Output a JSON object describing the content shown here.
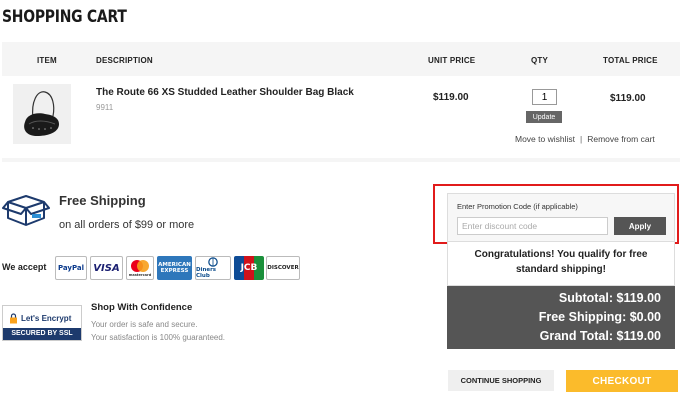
{
  "page": {
    "title": "SHOPPING CART"
  },
  "table": {
    "headers": {
      "item": "ITEM",
      "description": "DESCRIPTION",
      "unit_price": "UNIT PRICE",
      "qty": "QTY",
      "total_price": "TOTAL PRICE"
    }
  },
  "item": {
    "name": "The Route 66 XS Studded Leather Shoulder Bag Black",
    "sku": "9911",
    "unit_price": "$119.00",
    "qty": "1",
    "total_price": "$119.00",
    "update_label": "Update",
    "move_to_wishlist": "Move to wishlist",
    "separator": "|",
    "remove": "Remove from cart"
  },
  "shipping": {
    "title": "Free Shipping",
    "subtitle": "on all orders of $99 or more"
  },
  "payments": {
    "label": "We accept",
    "cards": [
      "PayPal",
      "VISA",
      "mastercard",
      "AMERICAN EXPRESS",
      "Diners Club",
      "JCB",
      "DISCOVER"
    ]
  },
  "security": {
    "badge_top": "Let's Encrypt",
    "badge_bottom": "SECURED BY SSL",
    "title": "Shop With Confidence",
    "line1": "Your order is safe and secure.",
    "line2": "Your satisfaction is 100% guaranteed."
  },
  "promo": {
    "label": "Enter Promotion Code (if applicable)",
    "placeholder": "Enter discount code",
    "value": "",
    "apply_label": "Apply"
  },
  "congrats": {
    "line1": "Congratulations! You qualify for free",
    "line2": "standard shipping!"
  },
  "totals": {
    "subtotal": "Subtotal: $119.00",
    "shipping": "Free Shipping: $0.00",
    "grand_total": "Grand Total: $119.00"
  },
  "actions": {
    "continue": "CONTINUE SHOPPING",
    "checkout": "CHECKOUT"
  },
  "colors": {
    "highlight": "#e11b1b",
    "checkout": "#fbbb2b",
    "totals_bg": "#555555",
    "ssl_blue": "#1d3a6d"
  }
}
